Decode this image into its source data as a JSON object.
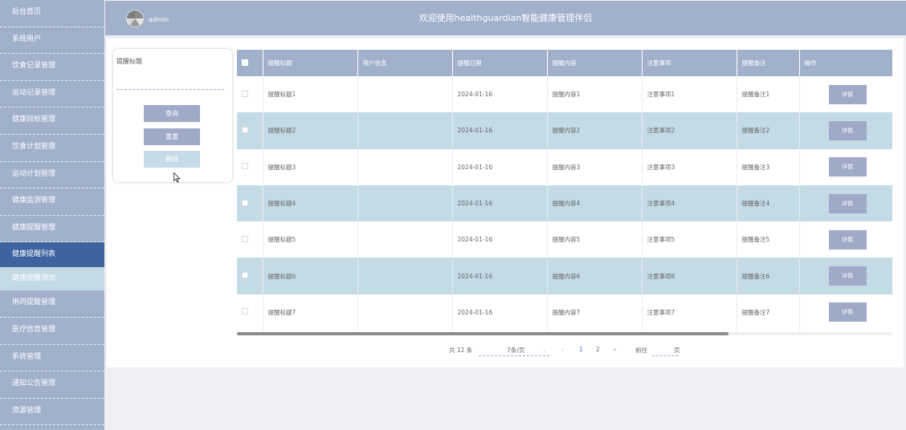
{
  "sidebar": {
    "items": [
      "后台首页",
      "系统用户",
      "饮食记录管理",
      "运动记录管理",
      "健康目标管理",
      "饮食计划管理",
      "运动计划管理",
      "健康监测管理",
      "健康提醒管理",
      "健康提醒列表",
      "健康提醒添加",
      "用药提醒管理",
      "医疗信息管理",
      "系统管理",
      "通知公告管理",
      "资源管理"
    ]
  },
  "header": {
    "username": "admin",
    "title": "欢迎使用healthguardian智能健康管理伴侣"
  },
  "search": {
    "label": "提醒标题",
    "query_label": "查询",
    "reset_label": "重置",
    "delete_label": "删除"
  },
  "table": {
    "columns": [
      "提醒标题",
      "用户信息",
      "提醒日期",
      "提醒内容",
      "注意事项",
      "提醒备注",
      "操作"
    ],
    "detail_label": "详情",
    "rows": [
      [
        "提醒标题1",
        "",
        "2024-01-16",
        "提醒内容1",
        "注意事项1",
        "提醒备注1"
      ],
      [
        "提醒标题2",
        "",
        "2024-01-16",
        "提醒内容2",
        "注意事项2",
        "提醒备注2"
      ],
      [
        "提醒标题3",
        "",
        "2024-01-16",
        "提醒内容3",
        "注意事项3",
        "提醒备注3"
      ],
      [
        "提醒标题4",
        "",
        "2024-01-16",
        "提醒内容4",
        "注意事项4",
        "提醒备注4"
      ],
      [
        "提醒标题5",
        "",
        "2024-01-16",
        "提醒内容5",
        "注意事项5",
        "提醒备注5"
      ],
      [
        "提醒标题6",
        "",
        "2024-01-16",
        "提醒内容6",
        "注意事项6",
        "提醒备注6"
      ],
      [
        "提醒标题7",
        "",
        "2024-01-16",
        "提醒内容7",
        "注意事项7",
        "提醒备注7"
      ]
    ]
  },
  "pagination": {
    "total": "共 12 条",
    "page_size": "7条/页",
    "prev": "‹",
    "page1": "1",
    "page2": "2",
    "next": "›",
    "goto_prefix": "前往",
    "goto_suffix": "页"
  },
  "colors": {
    "sidebar_bg": "#a1b1cc",
    "active_item": "#3d64a0",
    "stripe_row": "#c3dbe5",
    "accent_page": "#3d7be0"
  }
}
